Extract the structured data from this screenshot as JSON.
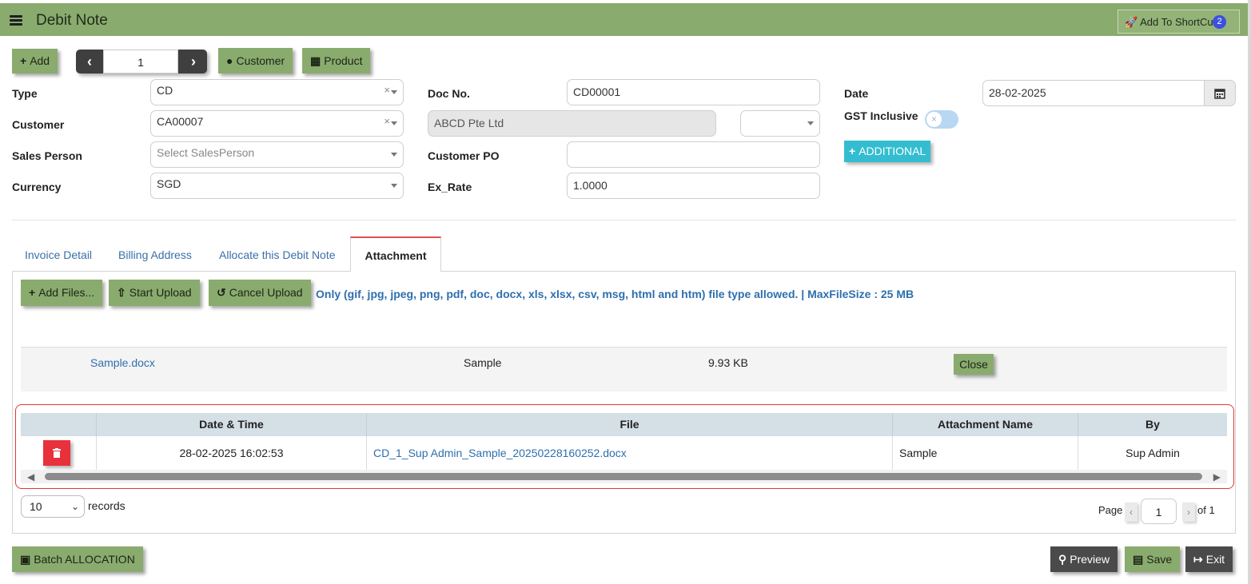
{
  "header": {
    "title": "Debit Note",
    "shortcut_label": "Add To ShortCut",
    "shortcut_badge": "2"
  },
  "toolbar": {
    "add_label": "Add",
    "record_number": "1",
    "customer_label": "Customer",
    "product_label": "Product"
  },
  "form": {
    "type_label": "Type",
    "type_value": "CD",
    "customer_label": "Customer",
    "customer_value": "CA00007",
    "sales_person_label": "Sales Person",
    "sales_person_placeholder": "Select SalesPerson",
    "currency_label": "Currency",
    "currency_value": "SGD",
    "doc_no_label": "Doc No.",
    "doc_no_value": "CD00001",
    "customer_name_value": "ABCD Pte Ltd",
    "customer_po_label": "Customer PO",
    "customer_po_value": "",
    "ex_rate_label": "Ex_Rate",
    "ex_rate_value": "1.0000",
    "date_label": "Date",
    "date_value": "28-02-2025",
    "gst_label": "GST Inclusive",
    "additional_label": "ADDITIONAL"
  },
  "tabs": [
    {
      "label": "Invoice Detail"
    },
    {
      "label": "Billing Address"
    },
    {
      "label": "Allocate this Debit Note"
    },
    {
      "label": "Attachment"
    }
  ],
  "attachment": {
    "add_files_label": "Add Files...",
    "start_upload_label": "Start Upload",
    "cancel_upload_label": "Cancel Upload",
    "note": "Only (gif, jpg, jpeg, png, pdf, doc, docx, xls, xlsx, csv, msg, html and htm) file type allowed. | MaxFileSize : 25 MB",
    "pending_file": {
      "name": "Sample.docx",
      "title": "Sample",
      "size": "9.93 KB",
      "close_label": "Close"
    }
  },
  "table": {
    "columns": [
      "Date & Time",
      "File",
      "Attachment Name",
      "By"
    ],
    "rows": [
      {
        "datetime": "28-02-2025 16:02:53",
        "file": "CD_1_Sup Admin_Sample_20250228160252.docx",
        "name": "Sample",
        "by": "Sup Admin"
      }
    ],
    "page_size": "10",
    "records_label": "records",
    "page_label": "Page",
    "current_page": "1",
    "of_label": "of 1"
  },
  "footer": {
    "batch_label": "Batch ALLOCATION",
    "preview_label": "Preview",
    "save_label": "Save",
    "exit_label": "Exit"
  },
  "colors": {
    "brand_green": "#8aab6e",
    "link_blue": "#2e6fad",
    "highlight_red": "#e53935",
    "accent_cyan": "#34bdd0"
  }
}
